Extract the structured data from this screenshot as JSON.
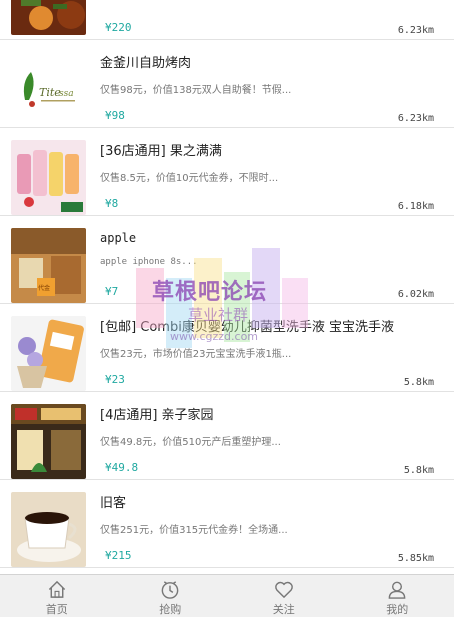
{
  "deals": [
    {
      "title": "",
      "desc": "",
      "price": "¥220",
      "distance": "6.23km"
    },
    {
      "title": "金釜川自助烤肉",
      "desc": "仅售98元，价值138元双人自助餐！节假...",
      "price": "¥98",
      "distance": "6.23km"
    },
    {
      "title": "[36店通用] 果之满满",
      "desc": "仅售8.5元，价值10元代金券，不限时...",
      "price": "¥8",
      "distance": "6.18km"
    },
    {
      "title": "apple",
      "desc": "apple iphone 8s...",
      "price": "¥7",
      "distance": "6.02km"
    },
    {
      "title": "[包邮] Combi康贝婴幼儿抑菌型洗手液 宝宝洗手液",
      "desc": "仅售23元，市场价值23元宝宝洗手液1瓶...",
      "price": "¥23",
      "distance": "5.8km"
    },
    {
      "title": "[4店通用] 亲子家园",
      "desc": "仅售49.8元，价值510元产后重塑护理...",
      "price": "¥49.8",
      "distance": "5.8km"
    },
    {
      "title": "旧客",
      "desc": "仅售251元，价值315元代金券！全场通...",
      "price": "¥215",
      "distance": "5.85km"
    }
  ],
  "thumbs": [
    "food-thumbnail",
    "logo-thumbnail",
    "smoothie-thumbnail",
    "room-thumbnail",
    "handsoap-thumbnail",
    "storefront-thumbnail",
    "coffee-thumbnail"
  ],
  "tabs": [
    {
      "label": "首页",
      "icon": "home-icon"
    },
    {
      "label": "抢购",
      "icon": "clock-icon"
    },
    {
      "label": "关注",
      "icon": "heart-icon"
    },
    {
      "label": "我的",
      "icon": "user-icon"
    }
  ],
  "watermark": {
    "line1": "草根吧论坛",
    "line2": "草业社群",
    "line3": "www.cgzzd.com"
  },
  "colors": {
    "price": "#21a9a1",
    "tabbar": "#f0f0f0"
  }
}
